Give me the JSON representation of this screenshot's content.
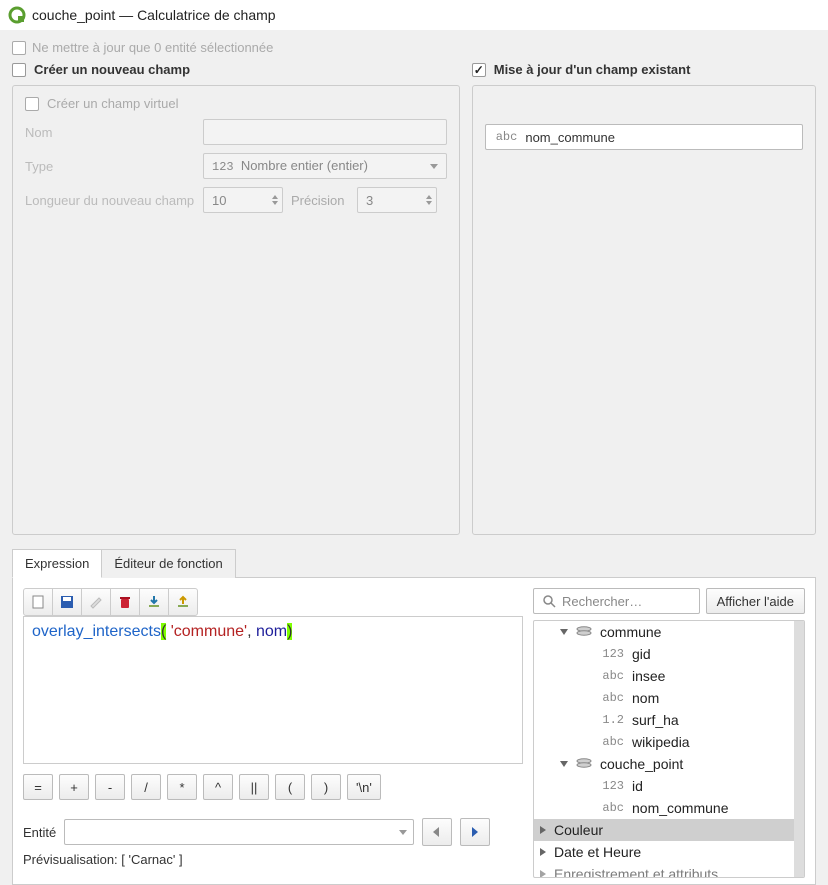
{
  "window": {
    "title": "couche_point — Calculatrice de champ"
  },
  "top": {
    "only_selected": "Ne mettre à jour que 0 entité sélectionnée"
  },
  "createPanel": {
    "title": "Créer un nouveau champ",
    "virtual": "Créer un champ virtuel",
    "nameLabel": "Nom",
    "typeLabel": "Type",
    "typeValue": "Nombre entier (entier)",
    "lenLabel": "Longueur du nouveau champ",
    "lenValue": "10",
    "precLabel": "Précision",
    "precValue": "3"
  },
  "updatePanel": {
    "title": "Mise à jour d'un champ existant",
    "fieldType": "abc",
    "fieldName": "nom_commune"
  },
  "tabs": {
    "expression": "Expression",
    "functionEditor": "Éditeur de fonction"
  },
  "expr": {
    "fn": "overlay_intersects",
    "open": "(",
    "arg1": " 'commune'",
    "comma": ", ",
    "arg2": "nom",
    "close": ")"
  },
  "operators": [
    "=",
    "+",
    "-",
    "/",
    "*",
    "^",
    "||",
    "(",
    ")",
    "'\\n'"
  ],
  "search": {
    "placeholder": "Rechercher…",
    "helpBtn": "Afficher l'aide"
  },
  "tree": {
    "layerA": {
      "name": "commune",
      "fields": [
        {
          "t": "123",
          "n": "gid"
        },
        {
          "t": "abc",
          "n": "insee"
        },
        {
          "t": "abc",
          "n": "nom"
        },
        {
          "t": "1.2",
          "n": "surf_ha"
        },
        {
          "t": "abc",
          "n": "wikipedia"
        }
      ]
    },
    "layerB": {
      "name": "couche_point",
      "fields": [
        {
          "t": "123",
          "n": "id"
        },
        {
          "t": "abc",
          "n": "nom_commune"
        }
      ]
    },
    "groups": [
      "Couleur",
      "Date et Heure",
      "Enregistrement et attributs"
    ]
  },
  "entity": {
    "label": "Entité"
  },
  "preview": {
    "label": "Prévisualisation: ",
    "value": "[ 'Carnac' ]"
  }
}
